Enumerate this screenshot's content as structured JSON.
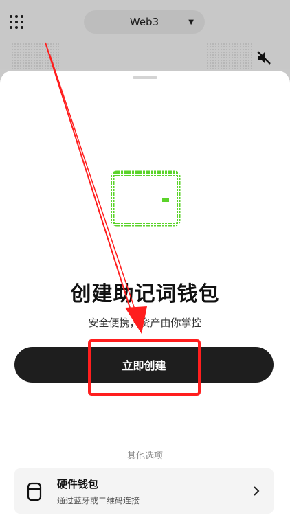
{
  "header": {
    "network_label": "Web3",
    "icons": {
      "menu": "grid-menu-icon",
      "network_caret": "caret-down-icon",
      "sound": "mute-icon"
    }
  },
  "sheet": {
    "title": "创建助记词钱包",
    "subtitle": "安全便携，资产由你掌控",
    "primary_button_label": "立即创建",
    "other_options_label": "其他选项",
    "hardware_wallet": {
      "title": "硬件钱包",
      "subtitle": "通过蓝牙或二维码连接",
      "icon": "hardware-wallet-icon",
      "chevron": "chevron-right-icon"
    }
  },
  "colors": {
    "wallet_accent": "#5bd32a",
    "button_bg": "#1e1e1e",
    "annotation_red": "#ff1e1e",
    "backdrop": "#c8c8c8"
  }
}
